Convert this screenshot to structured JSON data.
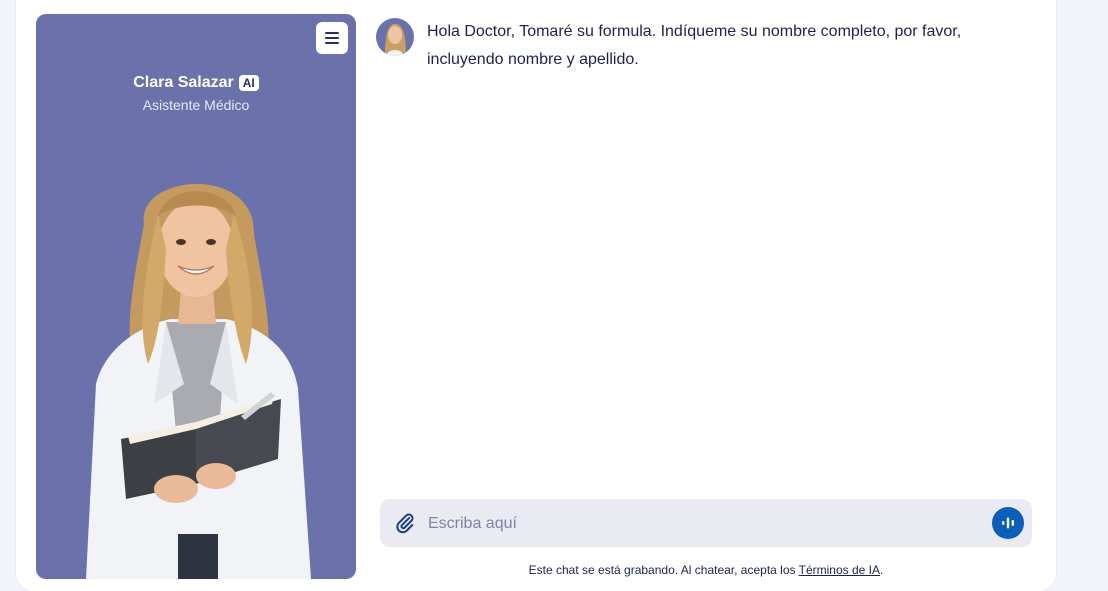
{
  "agent": {
    "name": "Clara Salazar",
    "badge": "AI",
    "role": "Asistente Médico"
  },
  "icons": {
    "menu": "hamburger-menu-icon",
    "attach": "paperclip-icon",
    "voice": "voice-wave-icon"
  },
  "chat": {
    "messages": [
      {
        "sender": "agent",
        "text": "Hola Doctor, Tomaré su formula. Indíqueme su nombre completo, por favor, incluyendo nombre y apellido."
      }
    ]
  },
  "composer": {
    "placeholder": "Escriba aquí",
    "value": ""
  },
  "footer": {
    "disclaimer_prefix": "Este chat se está grabando. Al chatear, acepta los ",
    "terms_link": "Términos de IA",
    "disclaimer_suffix": "."
  },
  "colors": {
    "panel": "#6b72ab",
    "accent": "#0b5fb8",
    "input_bg": "#e9eaf2",
    "text": "#1d2150"
  }
}
